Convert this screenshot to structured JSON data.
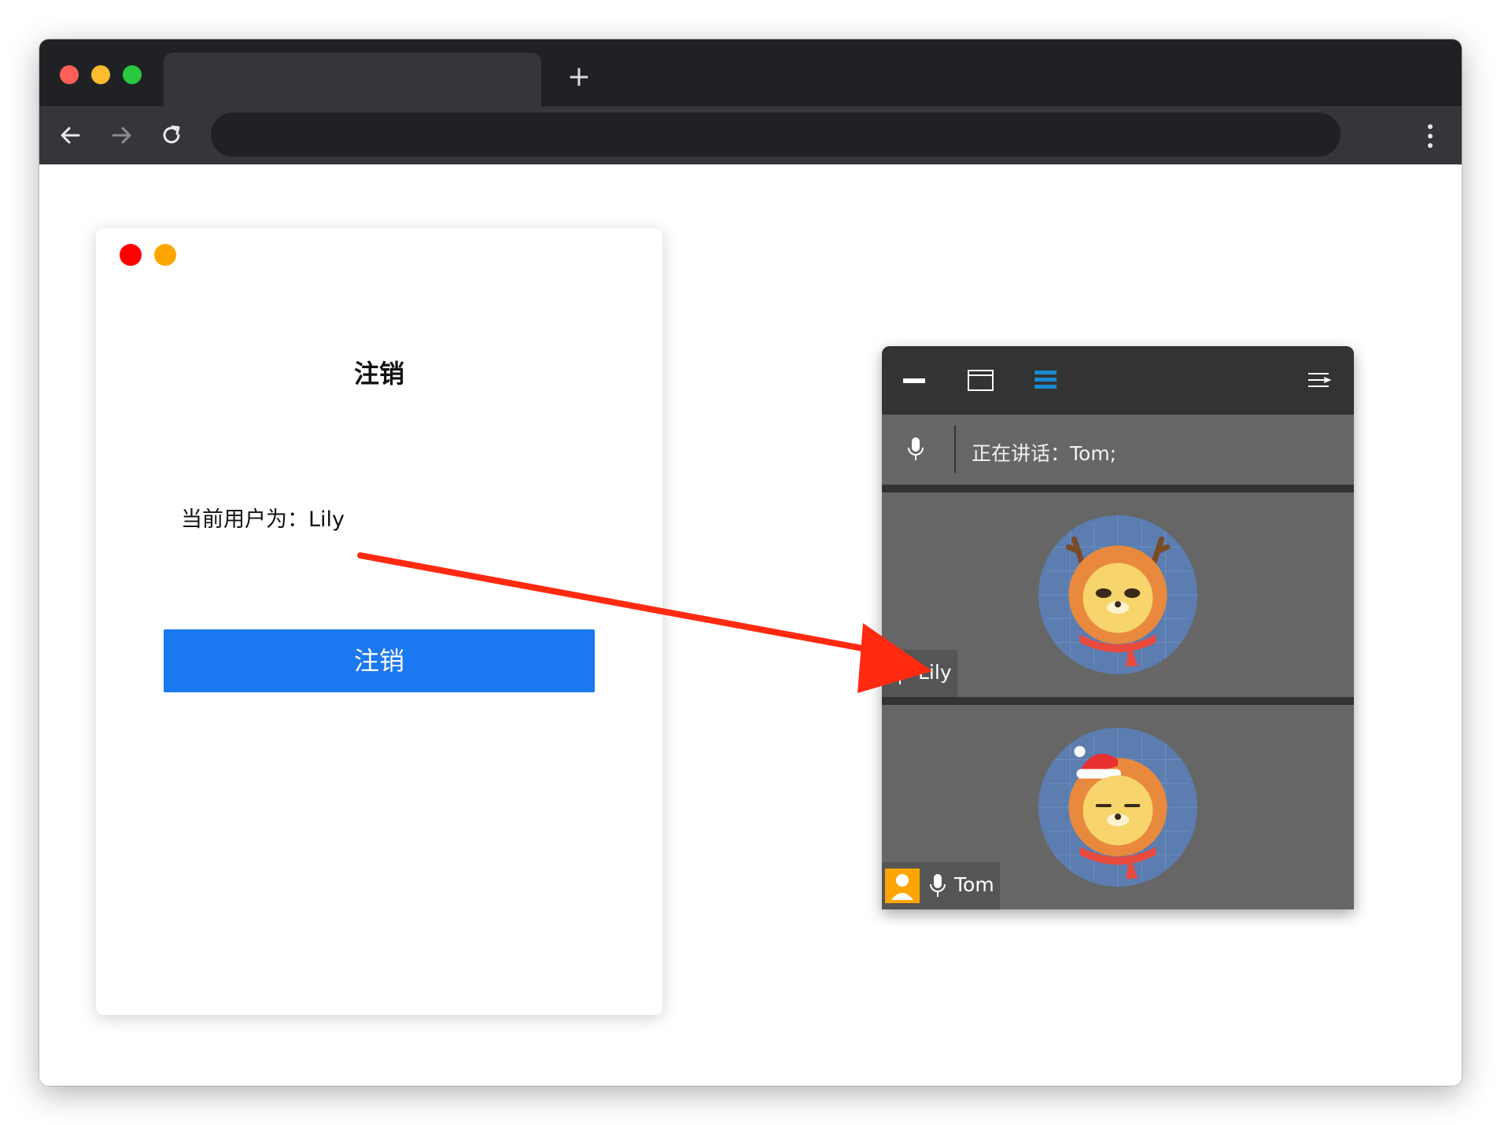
{
  "browser": {
    "new_tab_symbol": "+",
    "address_value": "",
    "icons": [
      "back-arrow-icon",
      "forward-arrow-icon",
      "reload-icon",
      "more-vert-icon"
    ]
  },
  "logout_card": {
    "title": "注销",
    "current_user_text": "当前用户为：Lily",
    "logout_button_label": "注销",
    "colors": {
      "button": "#1a78f0",
      "dot_red": "#ff0000",
      "dot_orange": "#ffa500"
    }
  },
  "conference_panel": {
    "speaking_text": "正在讲话：Tom;",
    "participants": [
      {
        "name": "Lily",
        "avatar": "reindeer-lion-avatar"
      },
      {
        "name": "Tom",
        "avatar": "santa-hat-lion-avatar",
        "host_badge": true
      }
    ],
    "colors": {
      "top_bar": "#333333",
      "tile_bg": "#666666",
      "list_icon": "#1a8ad0",
      "host_badge": "#ffa500"
    }
  },
  "annotation": {
    "arrow_color": "#ff2a10"
  }
}
